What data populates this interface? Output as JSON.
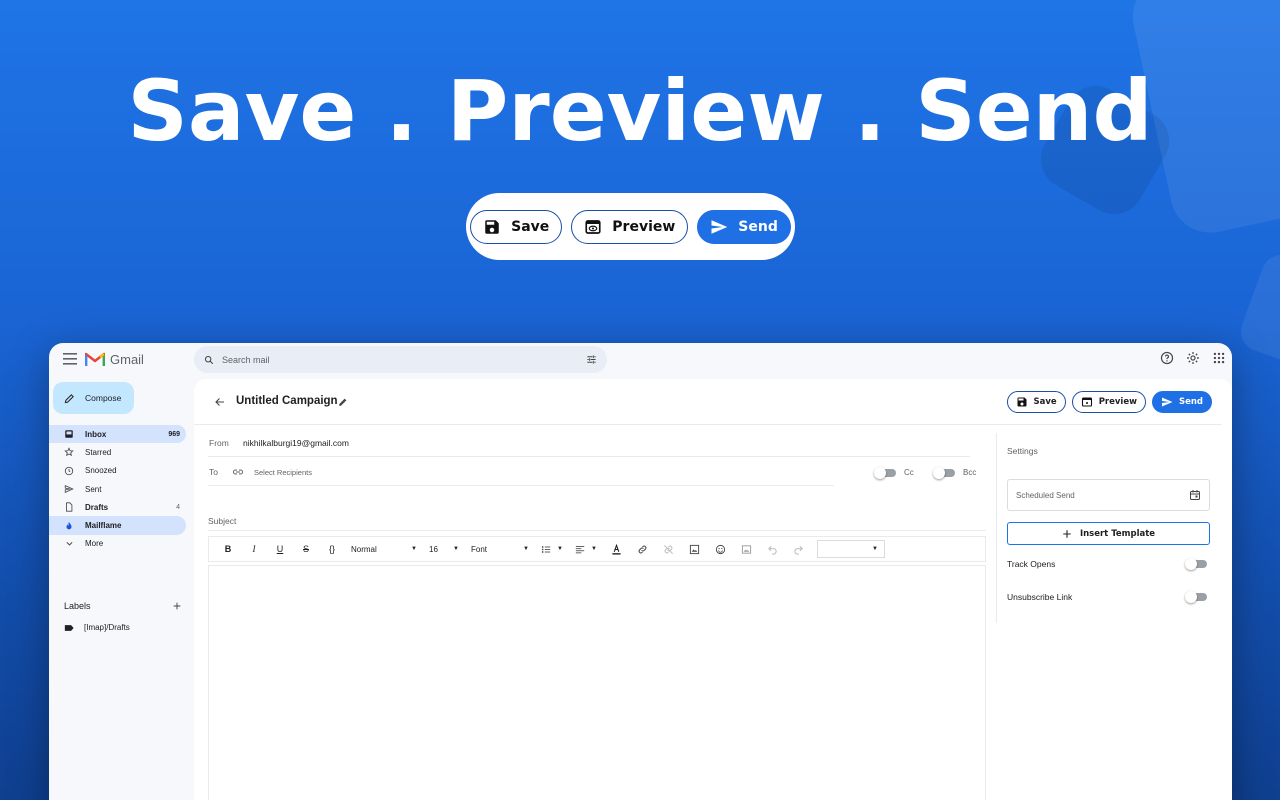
{
  "hero": {
    "title": "Save . Preview . Send",
    "buttons": {
      "save": "Save",
      "preview": "Preview",
      "send": "Send"
    }
  },
  "colors": {
    "accent": "#1f6fe5",
    "background": "#1a64d4",
    "selected_nav": "#d3e3fd",
    "compose": "#c2e7ff"
  },
  "gmail": {
    "brand": "Gmail",
    "search_placeholder": "Search mail",
    "compose_label": "Compose",
    "nav": [
      {
        "label": "Inbox",
        "count": "969",
        "icon": "inbox-icon"
      },
      {
        "label": "Starred",
        "count": "",
        "icon": "star-icon"
      },
      {
        "label": "Snoozed",
        "count": "",
        "icon": "clock-icon"
      },
      {
        "label": "Sent",
        "count": "",
        "icon": "send-icon"
      },
      {
        "label": "Drafts",
        "count": "4",
        "icon": "draft-icon"
      },
      {
        "label": "Mailflame",
        "count": "",
        "icon": "flame-icon"
      },
      {
        "label": "More",
        "count": "",
        "icon": "chevron-down-icon"
      }
    ],
    "labels_heading": "Labels",
    "labels": [
      {
        "label": "[Imap]/Drafts",
        "icon": "label-icon"
      }
    ]
  },
  "campaign": {
    "title": "Untitled Campaign",
    "buttons": {
      "save": "Save",
      "preview": "Preview",
      "send": "Send"
    },
    "from_label": "From",
    "from_value": "nikhilkalburgi19@gmail.com",
    "to_label": "To",
    "to_placeholder": "Select Recipients",
    "cc_label": "Cc",
    "bcc_label": "Bcc",
    "subject_placeholder": "Subject",
    "toolbar": {
      "bold": "B",
      "italic": "I",
      "underline": "U",
      "strike": "S",
      "code": "{}",
      "block_format": "Normal",
      "font_size": "16",
      "font_family": "Font"
    }
  },
  "settings": {
    "heading": "Settings",
    "scheduled_send_placeholder": "Scheduled Send",
    "insert_template": "Insert Template",
    "track_opens": "Track Opens",
    "unsubscribe_link": "Unsubscribe Link"
  }
}
